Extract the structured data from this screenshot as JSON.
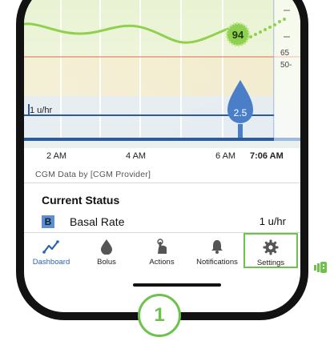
{
  "chart": {
    "glucose_value": "94",
    "label_65": "65",
    "label_50": "50-",
    "basal_axis_label": "1 u/hr",
    "bolus_value": "2.5",
    "time_labels": [
      "2 AM",
      "4 AM",
      "6 AM"
    ],
    "now_label": "7:06 AM"
  },
  "provider_text": "CGM Data by [CGM Provider]",
  "status": {
    "title": "Current Status",
    "basal_badge": "B",
    "basal_label": "Basal Rate",
    "basal_value": "1 u/hr"
  },
  "tabs": [
    {
      "label": "Dashboard",
      "icon": "trend-chart-icon"
    },
    {
      "label": "Bolus",
      "icon": "drop-icon"
    },
    {
      "label": "Actions",
      "icon": "tap-hand-icon"
    },
    {
      "label": "Notifications",
      "icon": "bell-icon"
    },
    {
      "label": "Settings",
      "icon": "gear-icon"
    }
  ],
  "callout_number": "1",
  "colors": {
    "accent": "#2a63b3",
    "highlight": "#6dc24b",
    "glucose_line": "#8fd14f"
  }
}
